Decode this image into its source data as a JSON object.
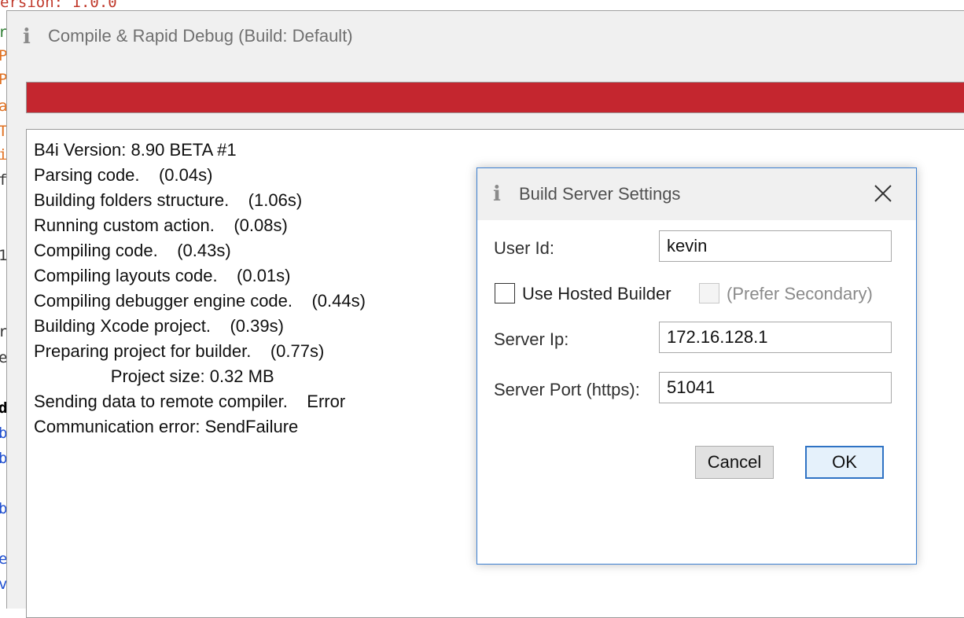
{
  "editor": {
    "top_text": "ersion: 1.0.0",
    "glyphs": [
      {
        "char": "r",
        "color": "#2e7d32"
      },
      {
        "char": "P",
        "color": "#e07020"
      },
      {
        "char": "P",
        "color": "#e07020"
      },
      {
        "char": "a",
        "color": "#e07020"
      },
      {
        "char": "T",
        "color": "#e07020"
      },
      {
        "char": "i",
        "color": "#e07020"
      },
      {
        "char": "f",
        "color": "#333333"
      },
      {
        "char": "1",
        "color": "#333333"
      },
      {
        "char": "r",
        "color": "#333333"
      },
      {
        "char": "e",
        "color": "#333333"
      },
      {
        "char": "d",
        "color": "#000000"
      },
      {
        "char": "b",
        "color": "#1f4fd0"
      },
      {
        "char": "b",
        "color": "#1f4fd0"
      },
      {
        "char": "b",
        "color": "#1f4fd0"
      },
      {
        "char": "e",
        "color": "#1f4fd0"
      },
      {
        "char": "v",
        "color": "#1f4fd0"
      }
    ]
  },
  "compile_window": {
    "icon": "info-icon",
    "title": "Compile & Rapid Debug (Build: Default)",
    "progress": {
      "status": "error",
      "fill_fraction": 1.0,
      "color": "#c4262f"
    },
    "log": [
      "B4i Version: 8.90 BETA #1",
      "Parsing code.    (0.04s)",
      "Building folders structure.    (1.06s)",
      "Running custom action.    (0.08s)",
      "Compiling code.    (0.43s)",
      "Compiling layouts code.    (0.01s)",
      "Compiling debugger engine code.    (0.44s)",
      "Building Xcode project.    (0.39s)",
      "Preparing project for builder.    (0.77s)",
      "                Project size: 0.32 MB",
      "Sending data to remote compiler.    Error",
      "Communication error: SendFailure"
    ]
  },
  "dialog": {
    "icon": "info-icon",
    "title": "Build Server Settings",
    "close_icon": "close-icon",
    "user_id": {
      "label": "User Id:",
      "value": "kevin"
    },
    "use_hosted_builder": {
      "label": "Use Hosted Builder",
      "checked": false
    },
    "prefer_secondary": {
      "label": "(Prefer Secondary)",
      "checked": false,
      "enabled": false
    },
    "server_ip": {
      "label": "Server Ip:",
      "value": "172.16.128.1"
    },
    "server_port": {
      "label": "Server Port (https):",
      "value": "51041"
    },
    "buttons": {
      "cancel": "Cancel",
      "ok": "OK"
    }
  },
  "colors": {
    "accent": "#3c7fd1",
    "error": "#c4262f"
  }
}
